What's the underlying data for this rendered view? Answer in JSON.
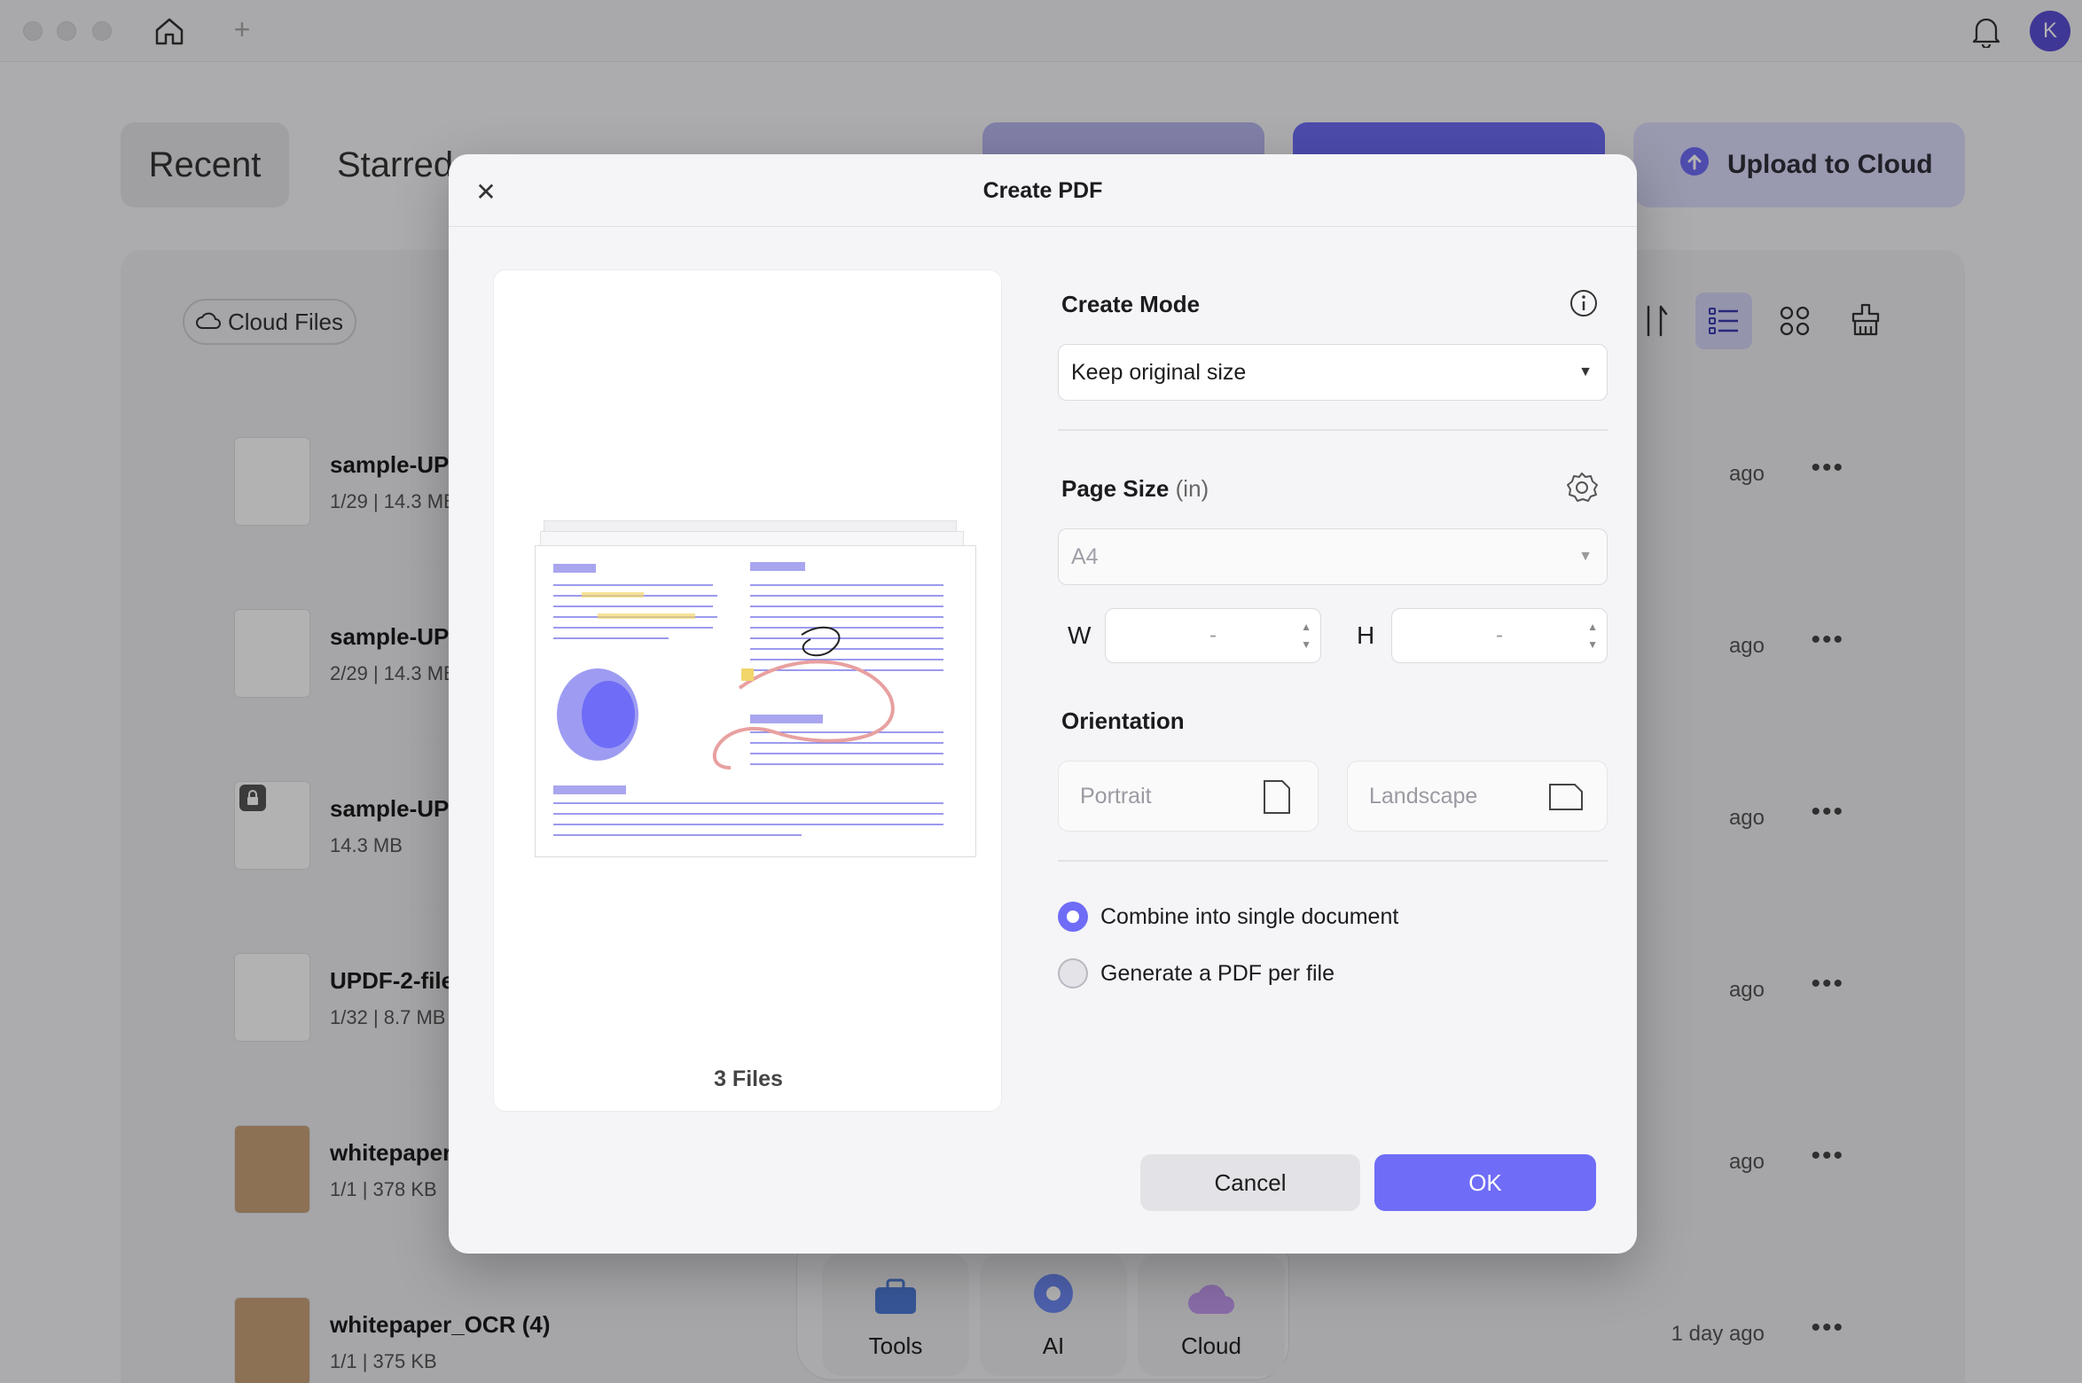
{
  "header": {
    "avatar_letter": "K"
  },
  "tabs": [
    {
      "label": "Recent"
    },
    {
      "label": "Starred"
    }
  ],
  "toolbar": {
    "upload_label": "Upload to Cloud",
    "cloud_files_label": "Cloud Files"
  },
  "files": [
    {
      "name": "sample-UPDF",
      "pages": "1/29",
      "size": "14.3 MB",
      "time": "ago"
    },
    {
      "name": "sample-UPDF",
      "pages": "2/29",
      "size": "14.3 MB",
      "time": "ago"
    },
    {
      "name": "sample-UPDF",
      "pages": "",
      "size": "14.3 MB",
      "time": "ago"
    },
    {
      "name": "UPDF-2-file",
      "pages": "1/32",
      "size": "8.7 MB",
      "time": "ago"
    },
    {
      "name": "whitepaper_",
      "pages": "1/1",
      "size": "378 KB",
      "time": "ago"
    },
    {
      "name": "whitepaper_OCR (4)",
      "pages": "1/1",
      "size": "375 KB",
      "time": "1 day ago"
    }
  ],
  "dock": [
    {
      "label": "Tools"
    },
    {
      "label": "AI"
    },
    {
      "label": "Cloud"
    }
  ],
  "dialog": {
    "title": "Create PDF",
    "preview": {
      "files_count": "3 Files"
    },
    "create_mode": {
      "label": "Create Mode",
      "value": "Keep original size"
    },
    "page_size": {
      "label": "Page Size",
      "unit": "(in)",
      "value": "A4",
      "w_label": "W",
      "h_label": "H",
      "w_value": "-",
      "h_value": "-"
    },
    "orientation": {
      "label": "Orientation",
      "portrait": "Portrait",
      "landscape": "Landscape"
    },
    "options": [
      {
        "label": "Combine into single document",
        "selected": true
      },
      {
        "label": "Generate a PDF per file",
        "selected": false
      }
    ],
    "cancel_label": "Cancel",
    "ok_label": "OK"
  },
  "colors": {
    "accent": "#6f6cf7",
    "avatar": "#5b4fd6",
    "upload_bg": "#dcdcfb"
  }
}
